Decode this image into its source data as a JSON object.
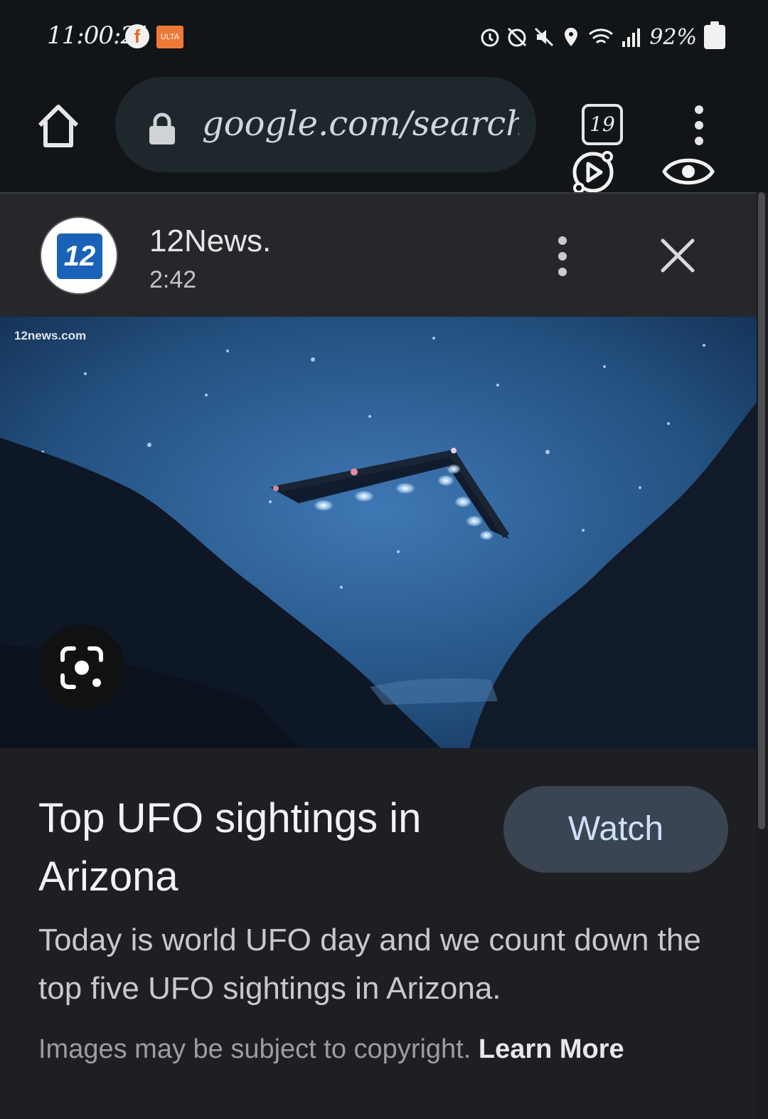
{
  "status_bar": {
    "time": "11:00:21",
    "notifications": [
      "facebook-notification",
      "ulta-notification"
    ],
    "ulta_label": "ULTA",
    "battery": "92%"
  },
  "browser": {
    "url": "google.com/search",
    "tab_count": "19"
  },
  "source": {
    "name": "12News.",
    "duration": "2:42",
    "logo_text": "12"
  },
  "media": {
    "watermark": "12news.com"
  },
  "card": {
    "title": "Top UFO sightings in Arizona",
    "watch_label": "Watch",
    "description": "Today is world UFO day and we count down the top five UFO sightings in Arizona.",
    "copyright_text": "Images may be subject to copyright.",
    "learn_more_label": "Learn More"
  }
}
